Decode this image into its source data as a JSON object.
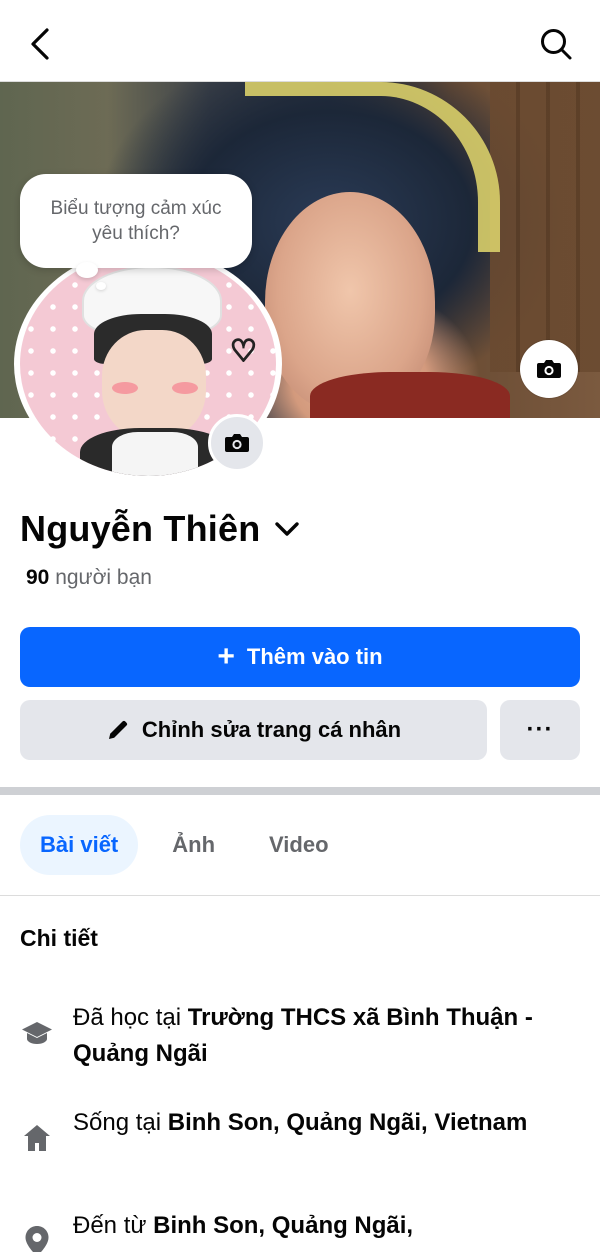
{
  "header": {
    "back_icon": "chevron-left-icon",
    "search_icon": "search-icon"
  },
  "cover": {
    "camera_icon": "camera-icon"
  },
  "avatar": {
    "bubble_text": "Biểu tượng cảm xúc yêu thích?",
    "camera_icon": "camera-icon"
  },
  "profile": {
    "name": "Nguyễn Thiên",
    "friends_count": "90",
    "friends_label": "người bạn"
  },
  "actions": {
    "add_story_label": "Thêm vào tin",
    "edit_profile_label": "Chỉnh sửa trang cá nhân",
    "more_label": "···"
  },
  "tabs": [
    {
      "label": "Bài viết",
      "active": true
    },
    {
      "label": "Ảnh",
      "active": false
    },
    {
      "label": "Video",
      "active": false
    }
  ],
  "details": {
    "title": "Chi tiết",
    "items": [
      {
        "icon": "education-cap-icon",
        "prefix": "Đã học tại ",
        "value": "Trường THCS xã Bình Thuận - Quảng Ngãi"
      },
      {
        "icon": "home-icon",
        "prefix": "Sống tại ",
        "value": "Binh Son, Quảng Ngãi, Vietnam"
      },
      {
        "icon": "location-pin-icon",
        "prefix": "Đến từ ",
        "value": "Binh Son, Quảng Ngãi,"
      }
    ]
  },
  "colors": {
    "primary": "#0866ff",
    "secondary_button": "#e4e6eb",
    "muted_text": "#65676b",
    "active_tab_bg": "#ebf5ff"
  }
}
